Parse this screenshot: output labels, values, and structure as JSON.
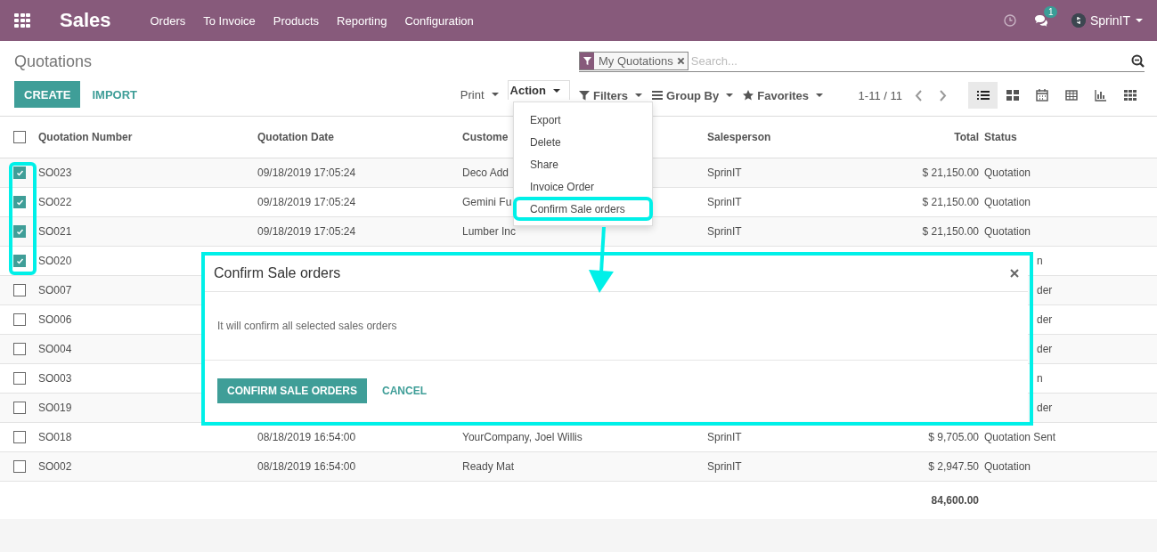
{
  "navbar": {
    "app": "Sales",
    "menus": [
      "Orders",
      "To Invoice",
      "Products",
      "Reporting",
      "Configuration"
    ],
    "messages_badge": "1",
    "user": "SprinIT"
  },
  "control_panel": {
    "title": "Quotations",
    "buttons": [
      {
        "label": "CREATE",
        "kind": "primary"
      },
      {
        "label": "IMPORT",
        "kind": "link"
      }
    ],
    "print": "Print",
    "action": {
      "label": "Action",
      "expanded": true
    },
    "search": {
      "facets": [
        {
          "label": "My Quotations"
        }
      ],
      "placeholder": "Search..."
    },
    "filters": [
      {
        "label": "Filters",
        "kind": "filter"
      },
      {
        "label": "Group By",
        "kind": "group"
      },
      {
        "label": "Favorites",
        "kind": "star"
      }
    ],
    "pager": "1-11 / 11",
    "views": [
      {
        "kind": "list",
        "selected": true
      },
      {
        "kind": "kanban",
        "selected": false
      },
      {
        "kind": "calendar",
        "selected": false
      },
      {
        "kind": "pivot",
        "selected": false
      },
      {
        "kind": "graph",
        "selected": false
      },
      {
        "kind": "grid",
        "selected": false
      }
    ]
  },
  "table": {
    "all_checked": false,
    "columns": [
      "Quotation Number",
      "Quotation Date",
      "Custome",
      "Salesperson",
      "Total",
      "Status"
    ],
    "rows": [
      {
        "checked": true,
        "partial": false,
        "cells": [
          "SO023",
          "09/18/2019 17:05:24",
          "Deco Add",
          "SprinIT",
          "$ 21,150.00",
          "Quotation"
        ]
      },
      {
        "checked": true,
        "partial": false,
        "cells": [
          "SO022",
          "09/18/2019 17:05:24",
          "Gemini Fu",
          "SprinIT",
          "$ 21,150.00",
          "Quotation"
        ]
      },
      {
        "checked": true,
        "partial": false,
        "cells": [
          "SO021",
          "09/18/2019 17:05:24",
          "Lumber Inc",
          "SprinIT",
          "$ 21,150.00",
          "Quotation"
        ]
      },
      {
        "checked": true,
        "partial": true,
        "cells": [
          "SO020",
          "n"
        ]
      },
      {
        "checked": false,
        "partial": true,
        "cells": [
          "SO007",
          "der"
        ]
      },
      {
        "checked": false,
        "partial": true,
        "cells": [
          "SO006",
          "der"
        ]
      },
      {
        "checked": false,
        "partial": true,
        "cells": [
          "SO004",
          "der"
        ]
      },
      {
        "checked": false,
        "partial": true,
        "cells": [
          "SO003",
          "n"
        ]
      },
      {
        "checked": false,
        "partial": true,
        "cells": [
          "SO019",
          "der"
        ]
      },
      {
        "checked": false,
        "partial": false,
        "cells": [
          "SO018",
          "08/18/2019 16:54:00",
          "YourCompany, Joel Willis",
          "SprinIT",
          "$ 9,705.00",
          "Quotation Sent"
        ]
      },
      {
        "checked": false,
        "partial": false,
        "cells": [
          "SO002",
          "08/18/2019 16:54:00",
          "Ready Mat",
          "SprinIT",
          "$ 2,947.50",
          "Quotation"
        ]
      }
    ],
    "total": "84,600.00"
  },
  "action_menu": {
    "items": [
      {
        "label": "Export"
      },
      {
        "label": "Delete"
      },
      {
        "label": "Share"
      },
      {
        "label": "Invoice Order"
      },
      {
        "label": "Confirm Sale orders"
      }
    ]
  },
  "dialog": {
    "title": "Confirm Sale orders",
    "message": "It will confirm all selected sales orders",
    "buttons": [
      {
        "label": "CONFIRM SALE ORDERS",
        "kind": "primary"
      },
      {
        "label": "CANCEL",
        "kind": "link"
      }
    ]
  },
  "annotations": [
    {
      "kind": "outline"
    },
    {
      "kind": "outline"
    },
    {
      "kind": "outline"
    },
    {
      "kind": "arrow"
    }
  ]
}
